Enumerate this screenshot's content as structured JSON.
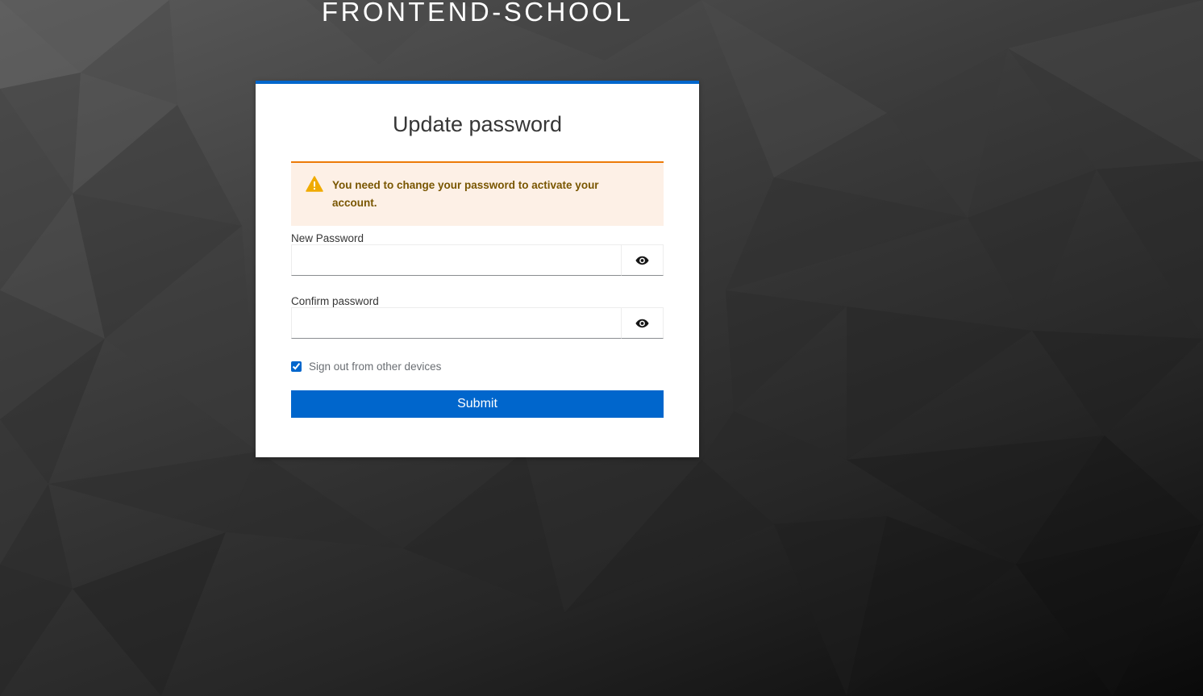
{
  "realm": {
    "title": "FRONTEND-SCHOOL"
  },
  "card": {
    "title": "Update password"
  },
  "alert": {
    "type": "warning",
    "message": "You need to change your password to activate your account."
  },
  "form": {
    "new_password": {
      "label": "New Password",
      "value": "",
      "toggle_icon": "eye-icon"
    },
    "confirm_password": {
      "label": "Confirm password",
      "value": "",
      "toggle_icon": "eye-icon"
    },
    "logout_sessions": {
      "label": "Sign out from other devices",
      "checked": true
    },
    "submit_label": "Submit"
  },
  "colors": {
    "primary": "#0066cc",
    "warning_border": "#ec7a08",
    "warning_bg": "#fdf0e6",
    "warning_text": "#795600"
  }
}
